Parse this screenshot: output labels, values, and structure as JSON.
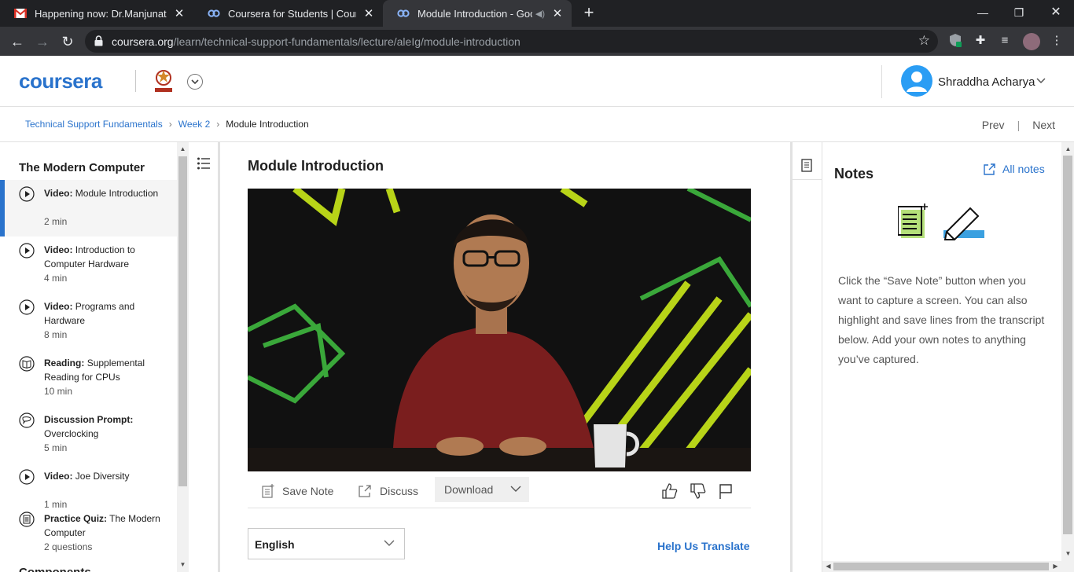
{
  "browser": {
    "tabs": [
      {
        "title": "Happening now: Dr.Manjunath K",
        "favicon": "gmail-icon",
        "close": "✕"
      },
      {
        "title": "Coursera for Students | Coursera",
        "favicon": "coursera-icon",
        "close": "✕"
      },
      {
        "title": "Module Introduction - Googl",
        "favicon": "coursera-icon",
        "close": "✕"
      }
    ],
    "new_tab": "+",
    "url_host": "coursera.org",
    "url_path": "/learn/technical-support-fundamentals/lecture/aleIg/module-introduction"
  },
  "header": {
    "logo": "coursera",
    "user_name": "Shraddha Acharya"
  },
  "breadcrumb": {
    "course": "Technical Support Fundamentals",
    "week": "Week 2",
    "current": "Module Introduction"
  },
  "nav": {
    "prev": "Prev",
    "next": "Next"
  },
  "sidebar": {
    "module_title": "The Modern Computer",
    "items": [
      {
        "type": "Video:",
        "title": "Module Introduction",
        "duration": "2 min",
        "icon": "play-icon"
      },
      {
        "type": "Video:",
        "title": "Introduction to Computer Hardware",
        "duration": "4 min",
        "icon": "play-icon"
      },
      {
        "type": "Video:",
        "title": "Programs and Hardware",
        "duration": "8 min",
        "icon": "play-icon"
      },
      {
        "type": "Reading:",
        "title": "Supplemental Reading for CPUs",
        "duration": "10 min",
        "icon": "book-icon"
      },
      {
        "type": "Discussion Prompt:",
        "title": "Overclocking",
        "duration": "5 min",
        "icon": "chat-icon"
      },
      {
        "type": "Video:",
        "title": "Joe Diversity",
        "duration": "1 min",
        "icon": "play-icon"
      },
      {
        "type": "Practice Quiz:",
        "title": "The Modern Computer",
        "duration": "2 questions",
        "icon": "quiz-icon"
      }
    ],
    "next_section": "Components"
  },
  "lecture": {
    "title": "Module Introduction",
    "save_note": "Save Note",
    "discuss": "Discuss",
    "download": "Download",
    "language": "English",
    "help_translate": "Help Us Translate"
  },
  "notes": {
    "title": "Notes",
    "all_notes": "All notes",
    "help_text": "Click the “Save Note” button when you want to capture a screen. You can also highlight and save lines from the transcript below. Add your own notes to anything you’ve captured."
  },
  "colors": {
    "brand_blue": "#2a73cc",
    "chrome_dark": "#202124",
    "chrome_tab": "#35363a",
    "avatar_blue": "#2a9df4",
    "notes_green": "#b5e07a",
    "highlight_blue": "#3aa0e0"
  }
}
